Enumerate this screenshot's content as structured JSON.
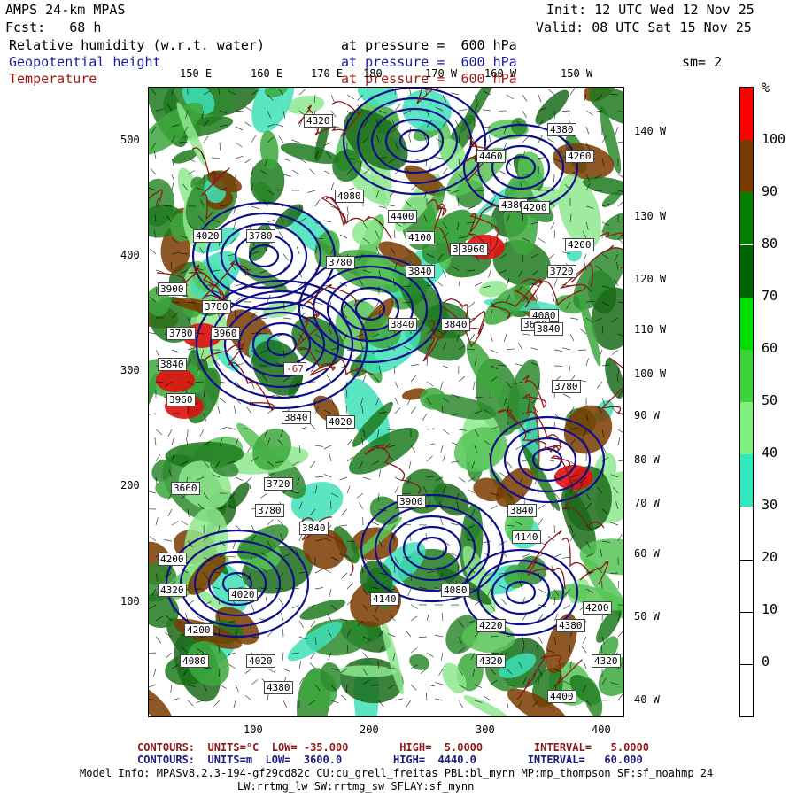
{
  "header": {
    "model": "AMPS 24-km MPAS",
    "fcst": "Fcst:   68 h",
    "init": "Init: 12 UTC Wed 12 Nov 25",
    "valid": "Valid: 08 UTC Sat 15 Nov 25",
    "fields": [
      {
        "name": "Relative humidity (w.r.t. water)",
        "level": "at pressure =  600 hPa",
        "color": "#000000"
      },
      {
        "name": "Geopotential height",
        "level": "at pressure =  600 hPa",
        "color": "#1a1aa6"
      },
      {
        "name": "Temperature",
        "level": "at pressure =  600 hPa",
        "color": "#a31616"
      }
    ],
    "smoothing": "sm= 2"
  },
  "map": {
    "top_lon_labels": [
      "150 E",
      "160 E",
      "170 E",
      "180",
      "170 W",
      "160 W",
      "150 W"
    ],
    "right_lon_labels": [
      "140 W",
      "130 W",
      "120 W",
      "110 W",
      "100 W",
      "90 W",
      "80 W",
      "70 W",
      "60 W",
      "50 W",
      "40 W"
    ],
    "x_ticks": [
      "100",
      "200",
      "300",
      "400"
    ],
    "y_ticks": [
      "500",
      "400",
      "300",
      "200",
      "100"
    ],
    "height_labels": [
      "4320",
      "4380",
      "4260",
      "4460",
      "4080",
      "4380",
      "4400",
      "4200",
      "4020",
      "3780",
      "4100",
      "4200",
      "3960",
      "3960",
      "3780",
      "3840",
      "3720",
      "3900",
      "3780",
      "4080",
      "3780",
      "3960",
      "3840",
      "3840",
      "3840",
      "3840",
      "4020",
      "3600",
      "3840",
      "3960",
      "3780",
      "3720",
      "3660",
      "3780",
      "3840",
      "3900",
      "3840",
      "4140",
      "4200",
      "4020",
      "4140",
      "4080",
      "4320",
      "4200",
      "4080",
      "4020",
      "4220",
      "4320",
      "4380",
      "4200",
      "4320",
      "4380",
      "4400"
    ],
    "temp_labels": [
      "-67"
    ]
  },
  "colorbar": {
    "unit": "%",
    "labels": [
      "100",
      "90",
      "80",
      "70",
      "60",
      "50",
      "40",
      "30",
      "20",
      "10",
      "0"
    ],
    "colors": [
      "#ff0000",
      "#7a3b00",
      "#008000",
      "#006400",
      "#00e000",
      "#3ad43a",
      "#7ef07e",
      "#30e8c0",
      "#ffffff",
      "#ffffff",
      "#ffffff",
      "#ffffff"
    ]
  },
  "footer": {
    "temp_contours": "CONTOURS:  UNITS=°C  LOW= -35.000        HIGH=  5.0000        INTERVAL=   5.0000",
    "hgt_contours": "CONTOURS:  UNITS=m  LOW=  3600.0        HIGH=  4440.0        INTERVAL=   60.000",
    "model_info_1": "Model Info: MPASv8.2.3-194-gf29cd82c CU:cu_grell_freitas PBL:bl_mynn MP:mp_thompson SF:sf_noahmp 24",
    "model_info_2": "LW:rrtmg_lw SW:rrtmg_sw SFLAY:sf_mynn"
  }
}
